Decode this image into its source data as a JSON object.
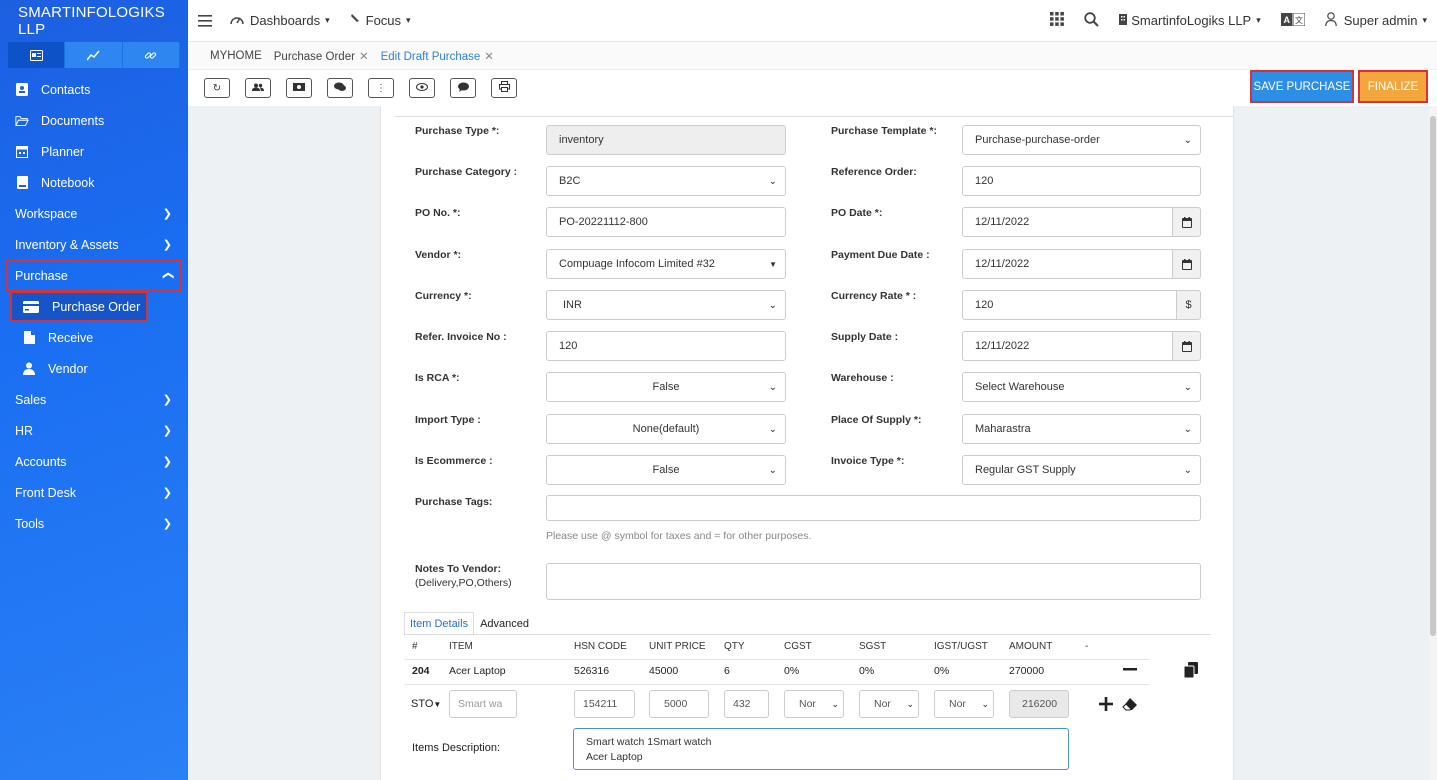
{
  "brand": "SMARTINFOLOGIKS LLP",
  "sidebar": {
    "items": [
      {
        "label": "Contacts"
      },
      {
        "label": "Documents"
      },
      {
        "label": "Planner"
      },
      {
        "label": "Notebook"
      },
      {
        "label": "Workspace"
      },
      {
        "label": "Inventory & Assets"
      },
      {
        "label": "Purchase"
      },
      {
        "label": "Purchase Order"
      },
      {
        "label": "Receive"
      },
      {
        "label": "Vendor"
      },
      {
        "label": "Sales"
      },
      {
        "label": "HR"
      },
      {
        "label": "Accounts"
      },
      {
        "label": "Front Desk"
      },
      {
        "label": "Tools"
      }
    ]
  },
  "topbar": {
    "dashboards": "Dashboards",
    "focus": "Focus",
    "company": "SmartinfoLogiks LLP",
    "user": "Super admin"
  },
  "tabs": {
    "home": "MYHOME",
    "purchase_order": "Purchase Order",
    "edit_draft": "Edit Draft Purchase"
  },
  "actions": {
    "save": "SAVE PURCHASE",
    "finalize": "FINALIZE"
  },
  "form": {
    "purchase_type_label": "Purchase Type *:",
    "purchase_type": "inventory",
    "purchase_template_label": "Purchase Template *:",
    "purchase_template": "Purchase-purchase-order",
    "purchase_category_label": "Purchase Category :",
    "purchase_category": "B2C",
    "reference_order_label": "Reference Order:",
    "reference_order": "120",
    "po_no_label": "PO No. *:",
    "po_no": "PO-20221112-800",
    "po_date_label": "PO Date *:",
    "po_date": "12/11/2022",
    "vendor_label": "Vendor *:",
    "vendor": "Compuage Infocom Limited #32",
    "payment_due_label": "Payment Due Date :",
    "payment_due": "12/11/2022",
    "currency_label": "Currency *:",
    "currency": "INR",
    "currency_rate_label": "Currency Rate * :",
    "currency_rate": "120",
    "currency_symbol": "$",
    "refer_invoice_label": "Refer. Invoice No :",
    "refer_invoice": "120",
    "supply_date_label": "Supply Date :",
    "supply_date": "12/11/2022",
    "is_rca_label": "Is RCA *:",
    "is_rca": "False",
    "warehouse_label": "Warehouse :",
    "warehouse": "Select Warehouse",
    "import_type_label": "Import Type :",
    "import_type": "None(default)",
    "place_supply_label": "Place Of Supply *:",
    "place_supply": "Maharastra",
    "is_ecommerce_label": "Is Ecommerce :",
    "is_ecommerce": "False",
    "invoice_type_label": "Invoice Type *:",
    "invoice_type": "Regular GST Supply",
    "purchase_tags_label": "Purchase Tags:",
    "purchase_tags": "",
    "tags_help": "Please use @ symbol for taxes and = for other purposes.",
    "notes_label_1": "Notes To Vendor:",
    "notes_label_2": "(Delivery,PO,Others)",
    "notes": ""
  },
  "items": {
    "tab_details": "Item Details",
    "tab_advanced": "Advanced",
    "headers": [
      "#",
      "ITEM",
      "HSN CODE",
      "UNIT PRICE",
      "QTY",
      "CGST",
      "SGST",
      "IGST/UGST",
      "AMOUNT",
      "-"
    ],
    "row": {
      "id": "204",
      "item": "Acer Laptop",
      "hsn": "526316",
      "price": "45000",
      "qty": "6",
      "cgst": "0%",
      "sgst": "0%",
      "igst": "0%",
      "amount": "270000"
    },
    "entry": {
      "type": "STO",
      "item_placeholder": "Smart wa",
      "hsn": "154211",
      "price": "5000",
      "qty": "432",
      "cgst": "Nor",
      "sgst": "Nor",
      "igst": "Nor",
      "amount": "216200"
    },
    "desc_label": "Items Description:",
    "desc_line1": "Smart watch 1Smart watch",
    "desc_line2": "Acer Laptop"
  }
}
